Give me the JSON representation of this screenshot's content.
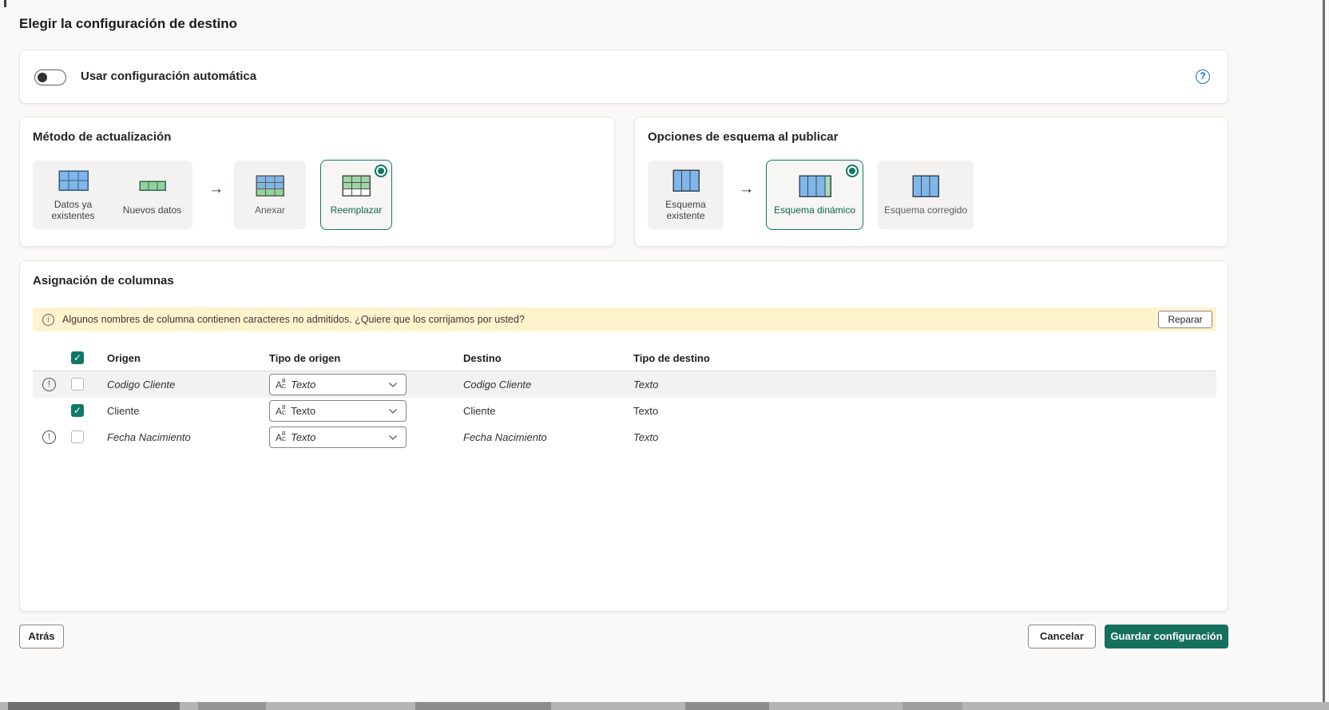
{
  "page": {
    "title": "Elegir la configuración de destino",
    "background": "#faf9f8",
    "accent_color": "#117865",
    "help_color": "#0b76c8",
    "warning_banner_color": "#fff4ce"
  },
  "auto_config": {
    "toggle_label": "Usar configuración automática",
    "enabled": false,
    "help_icon": "question-mark-circle-icon"
  },
  "update_method": {
    "title": "Método de actualización",
    "source_items": [
      {
        "label": "Datos ya existentes",
        "icon": "existing-data-table-icon"
      },
      {
        "label": "Nuevos datos",
        "icon": "new-data-row-icon"
      }
    ],
    "arrow_icon": "arrow-right-icon",
    "arrow_glyph": "→",
    "options": [
      {
        "label": "Anexar",
        "icon": "append-table-icon",
        "selected": false
      },
      {
        "label": "Reemplazar",
        "icon": "replace-table-icon",
        "selected": true
      }
    ]
  },
  "schema_options": {
    "title": "Opciones de esquema al publicar",
    "source_items": [
      {
        "label": "Esquema existente",
        "icon": "schema-columns-icon"
      }
    ],
    "arrow_icon": "arrow-right-icon",
    "arrow_glyph": "→",
    "options": [
      {
        "label": "Esquema dinámico",
        "icon": "schema-columns-dynamic-icon",
        "selected": true
      },
      {
        "label": "Esquema corregido",
        "icon": "schema-columns-icon",
        "selected": false
      }
    ]
  },
  "column_mapping": {
    "title": "Asignación de columnas",
    "warning": {
      "icon": "info-circle-icon",
      "text": "Algunos nombres de columna contienen caracteres no admitidos. ¿Quiere que los corrijamos por usted?",
      "action_label": "Reparar"
    },
    "table": {
      "select_all_checked": true,
      "headers": [
        "Origen",
        "Tipo de origen",
        "Destino",
        "Tipo de destino"
      ],
      "type_icon": "abc-text-type-icon",
      "type_icon_parts": {
        "a": "A",
        "b": "B",
        "c": "C"
      },
      "dropdown_icon": "chevron-down-icon",
      "rows": [
        {
          "warning": true,
          "checked": false,
          "origin": "Codigo Cliente",
          "origin_type": "Texto",
          "destination": "Codigo Cliente",
          "destination_type": "Texto",
          "italic": true,
          "highlighted": true
        },
        {
          "warning": false,
          "checked": true,
          "origin": "Cliente",
          "origin_type": "Texto",
          "destination": "Cliente",
          "destination_type": "Texto",
          "italic": false,
          "highlighted": false
        },
        {
          "warning": true,
          "checked": false,
          "origin": "Fecha Nacimiento",
          "origin_type": "Texto",
          "destination": "Fecha Nacimiento",
          "destination_type": "Texto",
          "italic": true,
          "highlighted": false
        }
      ]
    }
  },
  "footer": {
    "back_label": "Atrás",
    "cancel_label": "Cancelar",
    "save_label": "Guardar configuración"
  }
}
